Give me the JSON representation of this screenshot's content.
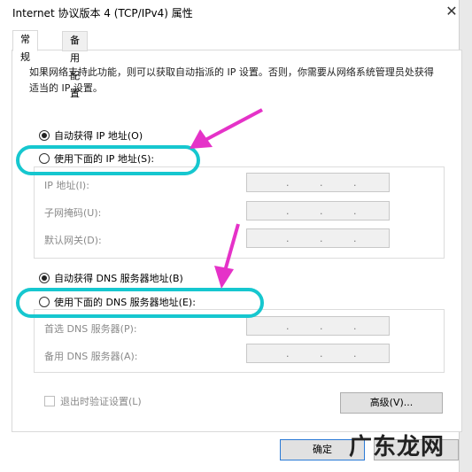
{
  "window": {
    "title": "Internet 协议版本 4 (TCP/IPv4) 属性",
    "close_icon": "close-icon"
  },
  "tabs": [
    {
      "label": "常规",
      "active": true
    },
    {
      "label": "备用配置",
      "active": false
    }
  ],
  "description": "如果网络支持此功能，则可以获取自动指派的 IP 设置。否则，你需要从网络系统管理员处获得适当的 IP 设置。",
  "ip_section": {
    "auto_option": {
      "label": "自动获得 IP 地址(O)",
      "selected": true
    },
    "manual_option": {
      "label": "使用下面的 IP 地址(S):",
      "selected": false
    },
    "fields": [
      {
        "label": "IP 地址(I):",
        "value": ". . ."
      },
      {
        "label": "子网掩码(U):",
        "value": ". . ."
      },
      {
        "label": "默认网关(D):",
        "value": ". . ."
      }
    ]
  },
  "dns_section": {
    "auto_option": {
      "label": "自动获得 DNS 服务器地址(B)",
      "selected": true
    },
    "manual_option": {
      "label": "使用下面的 DNS 服务器地址(E):",
      "selected": false
    },
    "fields": [
      {
        "label": "首选 DNS 服务器(P):",
        "value": ". . ."
      },
      {
        "label": "备用 DNS 服务器(A):",
        "value": ". . ."
      }
    ]
  },
  "validate_checkbox": {
    "label": "退出时验证设置(L)",
    "checked": false
  },
  "buttons": {
    "advanced": "高级(V)...",
    "ok": "确定"
  },
  "watermark": "广东龙网",
  "colors": {
    "highlight": "#16c7cf",
    "arrow": "#e532c8",
    "primary_border": "#2a7ad6"
  }
}
